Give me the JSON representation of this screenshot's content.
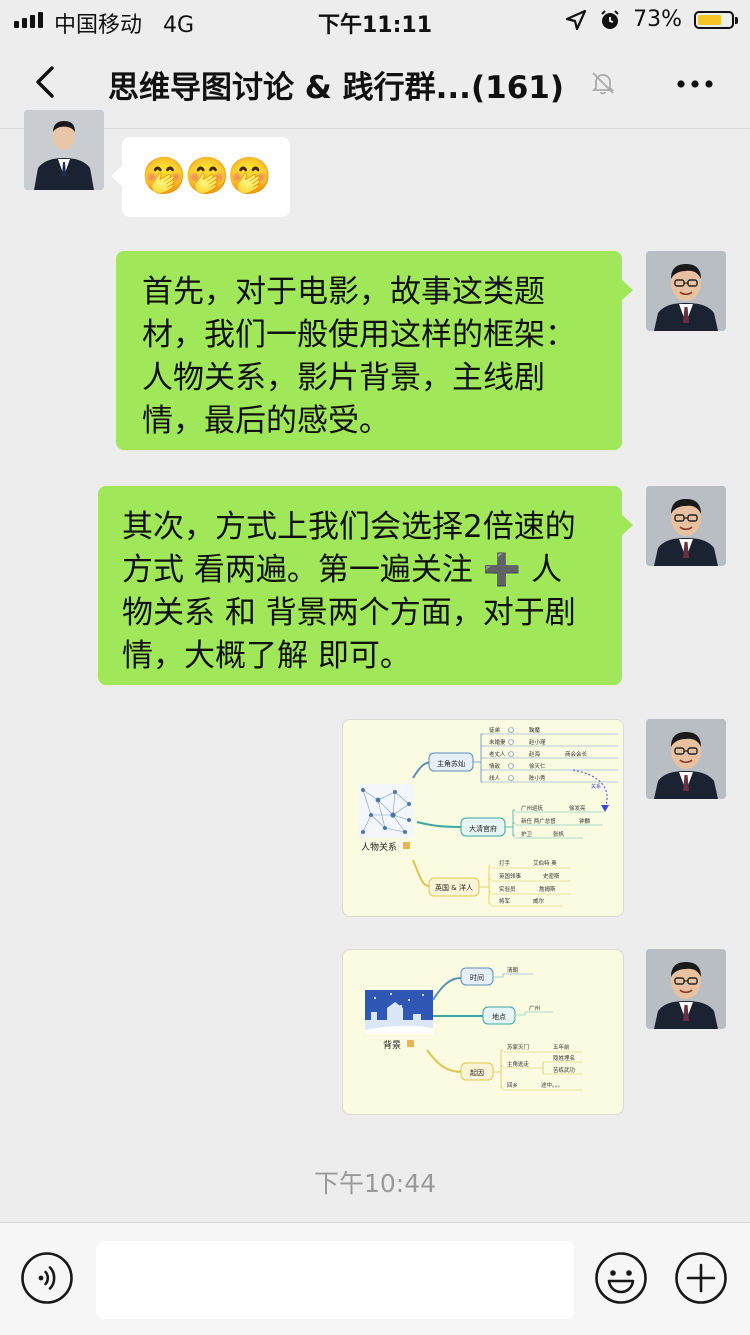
{
  "status_bar": {
    "carrier": "中国移动",
    "network": "4G",
    "time": "下午11:11",
    "battery": "73%",
    "battery_level": 0.73,
    "battery_color": "#f5c324"
  },
  "nav": {
    "title": "思维导图讨论 & 践行群...",
    "member_count": "(161)",
    "back_icon": "chevron-left-icon",
    "mute_icon": "bell-muted-icon",
    "more_icon": "more-dots-icon"
  },
  "messages": {
    "m0": {
      "sender": "other",
      "emoji": "🤭🤭🤭"
    },
    "m1": {
      "sender": "self",
      "lines": [
        "首先，对于电影，故事这类题",
        "材，我们一般使用这样的框架：",
        "人物关系，影片背景，主线剧",
        "情，最后的感受。"
      ]
    },
    "m2": {
      "sender": "self",
      "lines": [
        "其次，方式上我们会选择2倍速的",
        "方式 看两遍。第一遍关注 ➕ 人",
        "物关系 和 背景两个方面，对于剧",
        "情，大概了解 即可。"
      ]
    },
    "m3": {
      "sender": "self",
      "type": "image",
      "center": "人物关系",
      "branches": [
        {
          "label": "主角苏灿",
          "items": [
            {
              "a": "徒弟",
              "b": "鞠魔"
            },
            {
              "a": "未婚妻",
              "b": "赵小瑾"
            },
            {
              "a": "老丈人",
              "b": "赵海",
              "c": "商会会长"
            },
            {
              "a": "情敌",
              "b": "徐天仁"
            },
            {
              "a": "线人",
              "b": "陈小秀"
            }
          ]
        },
        {
          "label": "大清官府",
          "items": [
            {
              "a": "广州巡抚",
              "b": "徐发亮"
            },
            {
              "a": "新任 两广总督",
              "b": "钟麟"
            },
            {
              "a": "护卫",
              "b": "张帆"
            }
          ]
        },
        {
          "label": "英国 & 洋人",
          "items": [
            {
              "a": "打手",
              "b": "艾伯特 奥"
            },
            {
              "a": "英国领事",
              "b": "史密斯"
            },
            {
              "a": "实验员",
              "b": "詹姆斯"
            },
            {
              "a": "将军",
              "b": "威尔"
            }
          ]
        }
      ],
      "relation_note": "关系"
    },
    "m4": {
      "sender": "self",
      "type": "image",
      "center": "背景",
      "time_label": "时间",
      "time_value": "清朝",
      "place_label": "地点",
      "place_value": "广州",
      "cause_label": "起因",
      "cause_rows": [
        {
          "a": "苏家灭门",
          "b": "五年前"
        },
        {
          "a": "主角逃走",
          "b": "隐姓埋名"
        },
        {
          "a": "",
          "b": "苦练武功"
        },
        {
          "a": "回乡",
          "b": "途中。。。"
        }
      ]
    }
  },
  "timestamp": "下午10:44",
  "input": {
    "placeholder": "",
    "value": ""
  },
  "colors": {
    "self_bubble": "#a0e75a",
    "other_bubble": "#ffffff",
    "background": "#ededed"
  }
}
